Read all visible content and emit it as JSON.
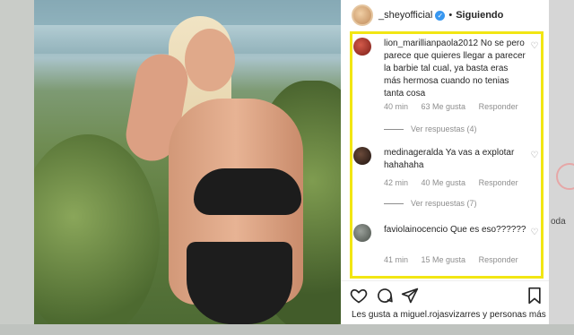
{
  "header": {
    "username": "_sheyofficial",
    "separator": "•",
    "follow_status": "Siguiendo"
  },
  "comments": [
    {
      "user": "lion_marillianpaola2012",
      "text": "No se pero parece que quieres llegar a parecer la barbie tal cual, ya basta eras más hermosa cuando no tenias tanta cosa",
      "time": "40 min",
      "likes": "63 Me gusta",
      "reply": "Responder",
      "view_replies": "Ver respuestas (4)"
    },
    {
      "user": "medinageralda",
      "text": "Ya vas a explotar hahahaha",
      "time": "42 min",
      "likes": "40 Me gusta",
      "reply": "Responder",
      "view_replies": "Ver respuestas (7)"
    },
    {
      "user": "faviolainocencio",
      "text": "Que es eso??????",
      "time": "41 min",
      "likes": "15 Me gusta",
      "reply": "Responder"
    }
  ],
  "footer": {
    "likes_text": "Les gusta a miguel.rojasvizarres y personas más"
  },
  "background_fragment": "oda",
  "colors": {
    "highlight": "#f2e613",
    "verified": "#3897f0"
  },
  "icons": [
    "heart-icon",
    "comment-icon",
    "share-icon",
    "bookmark-icon",
    "verified-icon"
  ]
}
